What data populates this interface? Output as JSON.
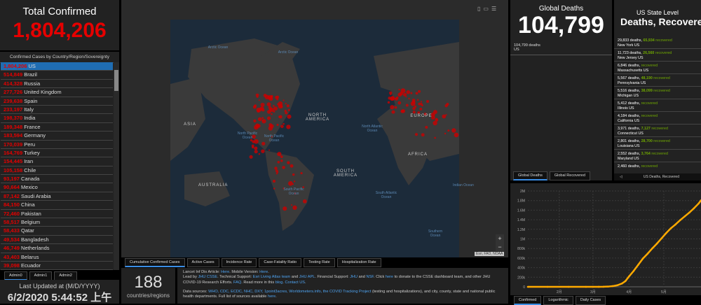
{
  "total": {
    "title": "Total Confirmed",
    "value": "1,804,206"
  },
  "list": {
    "header": "Confirmed Cases by Country/Region/Sovereignty",
    "rows": [
      [
        "1,804,206",
        "US"
      ],
      [
        "514,849",
        "Brazil"
      ],
      [
        "414,328",
        "Russia"
      ],
      [
        "277,726",
        "United Kingdom"
      ],
      [
        "239,638",
        "Spain"
      ],
      [
        "233,197",
        "Italy"
      ],
      [
        "198,370",
        "India"
      ],
      [
        "189,348",
        "France"
      ],
      [
        "183,594",
        "Germany"
      ],
      [
        "170,039",
        "Peru"
      ],
      [
        "164,769",
        "Turkey"
      ],
      [
        "154,445",
        "Iran"
      ],
      [
        "105,158",
        "Chile"
      ],
      [
        "93,197",
        "Canada"
      ],
      [
        "90,664",
        "Mexico"
      ],
      [
        "87,142",
        "Saudi Arabia"
      ],
      [
        "84,150",
        "China"
      ],
      [
        "72,460",
        "Pakistan"
      ],
      [
        "58,517",
        "Belgium"
      ],
      [
        "58,433",
        "Qatar"
      ],
      [
        "49,534",
        "Bangladesh"
      ],
      [
        "46,749",
        "Netherlands"
      ],
      [
        "43,403",
        "Belarus"
      ],
      [
        "39,098",
        "Ecuador"
      ]
    ],
    "tabs": [
      "Admin0",
      "Admin1",
      "Admin2"
    ]
  },
  "updated": {
    "label": "Last Updated at (M/D/YYYY)",
    "value": "6/2/2020 5:44:52 上午"
  },
  "map": {
    "labels": [
      "Arctic Ocean",
      "Arctic Ocean",
      "NORTH AMERICA",
      "EUROPE",
      "ASIA",
      "North Pacific Ocean",
      "North Pacific Ocean",
      "North Atlantic Ocean",
      "AFRICA",
      "SOUTH AMERICA",
      "AUSTRALIA",
      "South Pacific Ocean",
      "South Atlantic Ocean",
      "Indian Ocean",
      "Southern Ocean"
    ],
    "attribution": "Esri, FAO, NOAA",
    "zoom_in": "+",
    "zoom_out": "−",
    "tabs": [
      "Cumulative Confirmed Cases",
      "Active Cases",
      "Incidence Rate",
      "Case-Fatality Ratio",
      "Testing Rate",
      "Hospitalization Rate"
    ]
  },
  "count": {
    "value": "188",
    "label": "countries/regions"
  },
  "info": {
    "l1a": "Lancet Inf Dis Article: ",
    "here1": "Here",
    "l1b": ". Mobile Version: ",
    "here2": "Here",
    "l1c": ".",
    "l2a": "Lead by ",
    "jhu_csse": "JHU CSSE",
    "l2b": ". Technical Support: ",
    "esri": "Esri Living Atlas team",
    "and1": " and ",
    "jhuapl": "JHU APL",
    "l2c": ". Financial Support: ",
    "jhu": "JHU",
    "and2": " and ",
    "nsf": "NSF",
    "l2d": ". Click ",
    "here3": "here",
    "l2e": " to donate to the CSSE dashboard team, and other JHU COVID-19 Research Efforts. ",
    "faq": "FAQ",
    "l2f": ". Read more in this ",
    "blog": "blog",
    "l2g": ". ",
    "contact": "Contact US",
    "l2h": ".",
    "l3a": "Data sources: ",
    "sources": "WHO, CDC, ECDC, NHC, DXY, 1point3acres, Worldometers.info, the COVID Tracking Project",
    "l3b": " (testing and hospitalizations), and city, county, state and national public health departments. Full list of sources available ",
    "here4": "here",
    "l3c": "."
  },
  "global_deaths": {
    "title": "Global Deaths",
    "value": "104,799",
    "sub_value": "104,799 deaths",
    "sub_place": "US",
    "tabs": [
      "Global Deaths",
      "Global Recovered"
    ]
  },
  "us_state": {
    "title": "US State Level",
    "heading": "Deaths, Recovered",
    "footer": "US Deaths, Recovered",
    "nav": "◁",
    "rows": [
      [
        "29,833 deaths,",
        "65,934",
        "recovered",
        "New York US"
      ],
      [
        "11,723 deaths,",
        "26,560",
        "recovered",
        "New Jersey US"
      ],
      [
        "6,846 deaths,",
        "",
        "recovered",
        "Massachusetts US"
      ],
      [
        "5,567 deaths,",
        "48,190",
        "recovered",
        "Pennsylvania US"
      ],
      [
        "5,516 deaths,",
        "38,099",
        "recovered",
        "Michigan US"
      ],
      [
        "5,412 deaths,",
        "",
        "recovered",
        "Illinois US"
      ],
      [
        "4,184 deaths,",
        "",
        "recovered",
        "California US"
      ],
      [
        "3,971 deaths,",
        "7,127",
        "recovered",
        "Connecticut US"
      ],
      [
        "2,801 deaths,",
        "28,700",
        "recovered",
        "Louisiana US"
      ],
      [
        "2,552 deaths,",
        "3,764",
        "recovered",
        "Maryland US"
      ],
      [
        "2,460 deaths,",
        "",
        "recovered",
        ""
      ]
    ]
  },
  "chart_data": {
    "type": "line",
    "title": "",
    "xlabel": "",
    "ylabel": "",
    "x": [
      22,
      40,
      55,
      61,
      66,
      70,
      74,
      78,
      82,
      86,
      89,
      92,
      96,
      100,
      104,
      108,
      112,
      116,
      120,
      124,
      128,
      132,
      136,
      140,
      144,
      148,
      152,
      154
    ],
    "y": [
      1,
      15,
      60,
      75,
      200,
      1000,
      4600,
      14000,
      33000,
      69000,
      120000,
      215000,
      330000,
      460000,
      590000,
      690000,
      800000,
      900000,
      1010000,
      1120000,
      1220000,
      1300000,
      1390000,
      1470000,
      1550000,
      1640000,
      1740000,
      1804206
    ],
    "series_name": "Confirmed",
    "color": "#ffaa00",
    "yticks": [
      0,
      200000,
      400000,
      600000,
      800000,
      1000000,
      1200000,
      1400000,
      1600000,
      1800000,
      2000000
    ],
    "yticklabels": [
      "0",
      "200k",
      "400k",
      "600k",
      "800k",
      "1M",
      "1.2M",
      "1.4M",
      "1.6M",
      "1.8M",
      "2M"
    ],
    "xticks": [
      32,
      61,
      92,
      122
    ],
    "xticklabels": [
      "2月",
      "3月",
      "4月",
      "5月"
    ],
    "xlim": [
      5,
      154
    ],
    "ylim": [
      0,
      2000000
    ],
    "grid": true,
    "tabs": [
      "Confirmed",
      "Logarithmic",
      "Daily Cases"
    ]
  }
}
